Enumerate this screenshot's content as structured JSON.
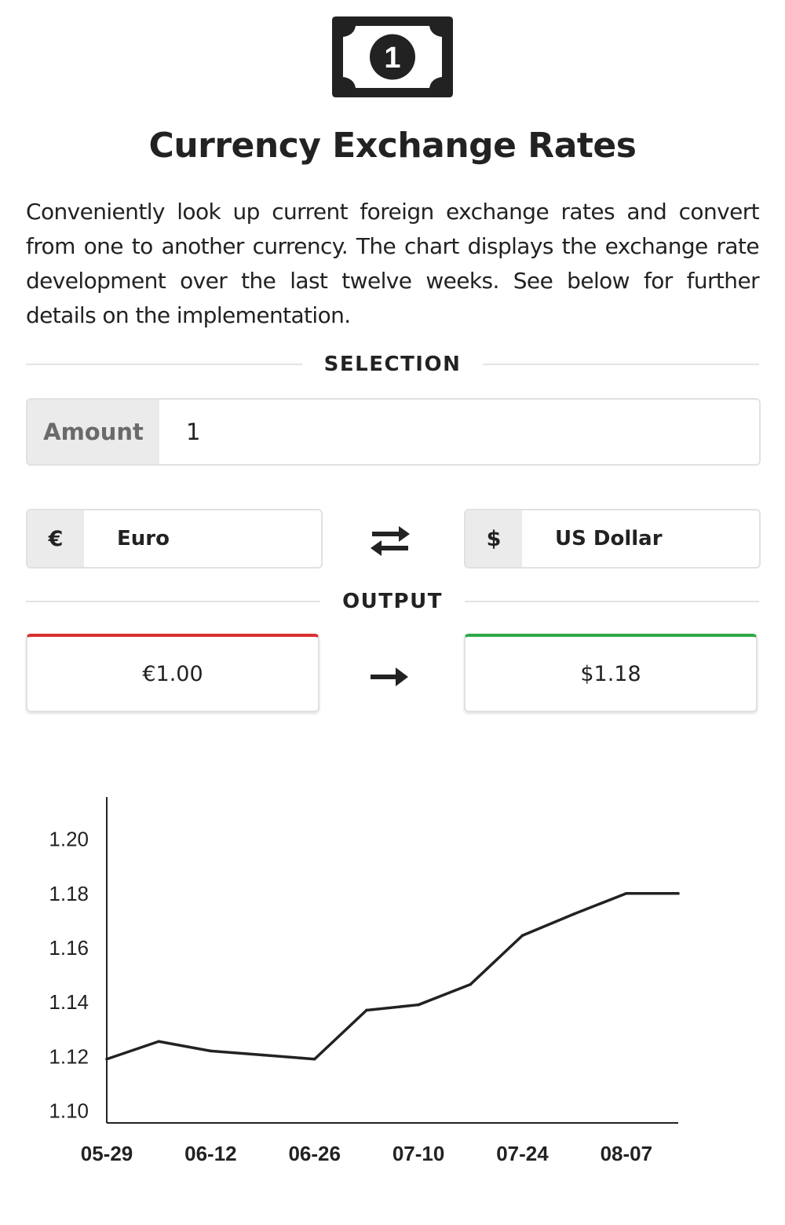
{
  "header": {
    "logo_icon": "dollar-bill-icon",
    "logo_digit": "1",
    "title": "Currency Exchange Rates",
    "description": "Conveniently look up current foreign exchange rates and convert from one to another currency. The chart displays the exchange rate development over the last twelve weeks. See below for further details on the implementation."
  },
  "selection": {
    "heading": "SELECTION",
    "amount_label": "Amount",
    "amount_value": "1",
    "from": {
      "symbol": "€",
      "name": "Euro"
    },
    "to": {
      "symbol": "$",
      "name": "US Dollar"
    },
    "swap_icon": "swap-arrows-icon"
  },
  "output": {
    "heading": "OUTPUT",
    "from_value": "€1.00",
    "to_value": "$1.18",
    "from_accent": "#d9302f",
    "to_accent": "#2fa94a",
    "arrow_icon": "arrow-right-icon"
  },
  "chart_data": {
    "type": "line",
    "x": [
      "05-29",
      "06-05",
      "06-12",
      "06-19",
      "06-26",
      "07-03",
      "07-10",
      "07-17",
      "07-24",
      "07-31",
      "08-07",
      "08-14"
    ],
    "series": [
      {
        "values": [
          1.119,
          1.1255,
          1.122,
          1.1205,
          1.119,
          1.137,
          1.139,
          1.1465,
          1.1645,
          1.1725,
          1.18,
          1.18
        ]
      }
    ],
    "x_tick_labels": [
      "05-29",
      "06-12",
      "06-26",
      "07-10",
      "07-24",
      "08-07"
    ],
    "y_ticks": [
      "1.10",
      "1.12",
      "1.14",
      "1.16",
      "1.18",
      "1.20"
    ],
    "ylim": [
      1.0955,
      1.2155
    ],
    "grid": false,
    "line_color": "#222222"
  }
}
